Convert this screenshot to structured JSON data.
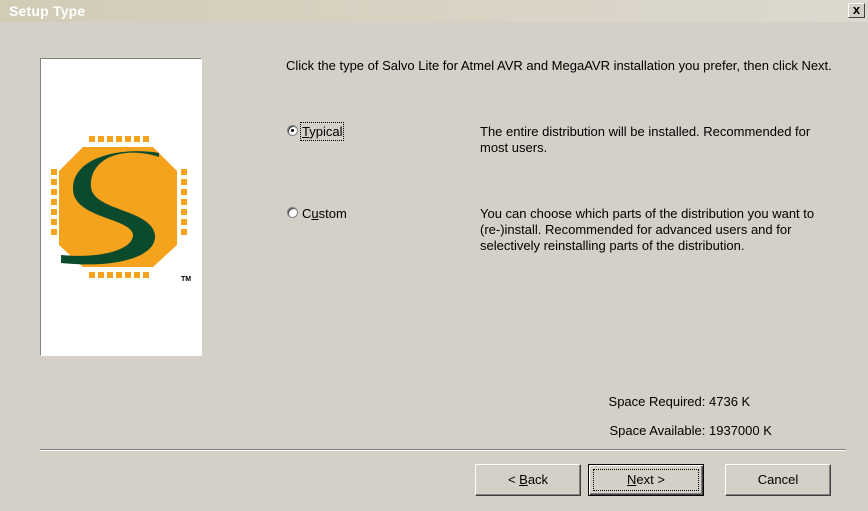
{
  "window": {
    "title": "Setup Type",
    "close_glyph": "x"
  },
  "logo": {
    "letter": "S",
    "trademark": "TM",
    "colors": {
      "chip": "#f5a21d",
      "letter": "#0c4a2e",
      "pins": "#f5a21d"
    }
  },
  "instruction": "Click the type of Salvo Lite for Atmel AVR and MegaAVR installation you prefer, then click Next.",
  "options": [
    {
      "label_pre": "",
      "label_mnemonic": "T",
      "label_post": "ypical",
      "selected": true,
      "description": "The entire distribution will be installed. Recommended for most users."
    },
    {
      "label_pre": "C",
      "label_mnemonic": "u",
      "label_post": "stom",
      "selected": false,
      "description": "You can choose which parts of the distribution you want to (re-)install. Recommended for advanced users and for selectively reinstalling parts of the distribution."
    }
  ],
  "space": {
    "required_label": "Space Required:",
    "required_value": "4736 K",
    "available_label": "Space Available:",
    "available_value": "1937000 K"
  },
  "buttons": {
    "back_pre": "< ",
    "back_mnemonic": "B",
    "back_post": "ack",
    "next_mnemonic": "N",
    "next_post": "ext >",
    "cancel": "Cancel"
  }
}
